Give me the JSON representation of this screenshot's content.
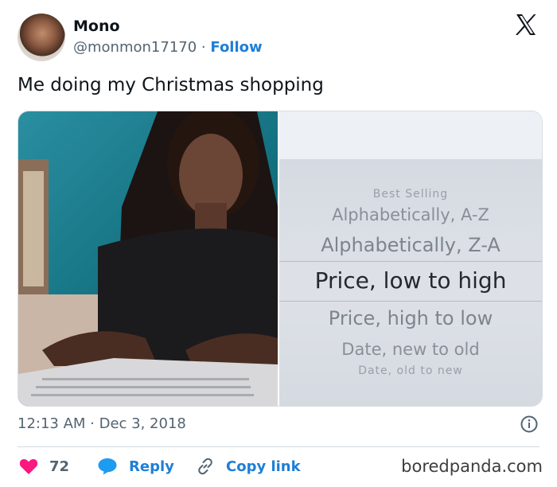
{
  "tweet": {
    "author_name": "Mono",
    "handle": "@monmon17170",
    "separator": "·",
    "follow_label": "Follow",
    "text": "Me doing my Christmas shopping",
    "timestamp": "12:13 AM · Dec 3, 2018",
    "actions": {
      "like_count": "72",
      "reply_label": "Reply",
      "copy_link_label": "Copy link"
    }
  },
  "media": {
    "sort_picker": {
      "options": [
        "Best Selling",
        "Alphabetically, A-Z",
        "Alphabetically, Z-A",
        "Price, low to high",
        "Price, high to low",
        "Date, new to old",
        "Date, old to new"
      ],
      "selected": "Price, low to high"
    }
  },
  "watermark": "boredpanda.com",
  "colors": {
    "accent": "#1d7fd6",
    "like": "#f91880",
    "muted": "#536471"
  },
  "icons": [
    "x-logo-icon",
    "info-icon",
    "heart-icon",
    "reply-icon",
    "link-icon"
  ]
}
